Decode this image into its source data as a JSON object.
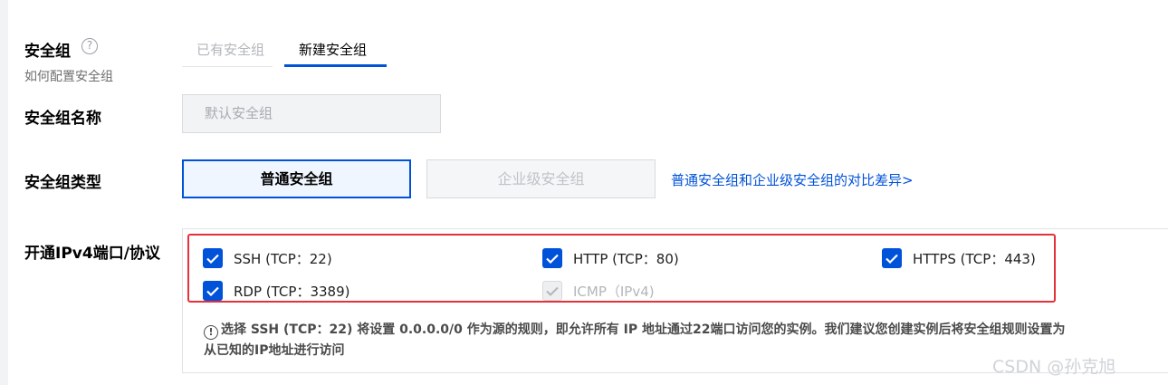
{
  "security_group": {
    "label": "安全组",
    "help_icon": "?",
    "sublabel": "如何配置安全组",
    "tabs": [
      {
        "label": "已有安全组",
        "active": false
      },
      {
        "label": "新建安全组",
        "active": true
      }
    ]
  },
  "group_name": {
    "label": "安全组名称",
    "placeholder": "默认安全组"
  },
  "group_type": {
    "label": "安全组类型",
    "options": [
      {
        "label": "普通安全组",
        "selected": true
      },
      {
        "label": "企业级安全组",
        "selected": false,
        "disabled": true
      }
    ],
    "compare_link": "普通安全组和企业级安全组的对比差异>"
  },
  "protocols": {
    "label": "开通IPv4端口/协议",
    "items": [
      {
        "label": "SSH (TCP：22)",
        "checked": true,
        "disabled": false
      },
      {
        "label": "HTTP (TCP：80)",
        "checked": true,
        "disabled": false
      },
      {
        "label": "HTTPS (TCP：443)",
        "checked": true,
        "disabled": false
      },
      {
        "label": "RDP (TCP：3389)",
        "checked": true,
        "disabled": false
      },
      {
        "label": "ICMP（IPv4)",
        "checked": true,
        "disabled": true
      }
    ],
    "notice_icon": "!",
    "notice_line1": "选择 SSH (TCP：22) 将设置 0.0.0.0/0 作为源的规则，即允许所有 IP 地址通过22端口访问您的实例。我们建议您创建实例后将安全组规则设置为",
    "notice_line2": "从已知的IP地址进行访问"
  },
  "colors": {
    "primary": "#0052d9",
    "highlight_border": "#e5313a",
    "disabled_text": "#b3b6bb"
  },
  "watermark": "CSDN @孙克旭"
}
